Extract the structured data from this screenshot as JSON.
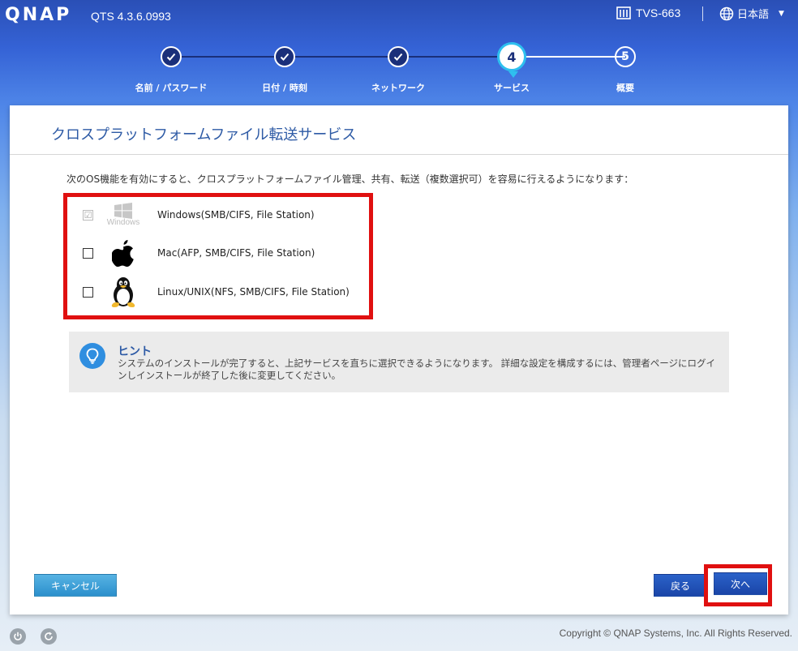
{
  "header": {
    "logo": "QNAP",
    "version": "QTS 4.3.6.0993",
    "device_name": "TVS-663",
    "language": "日本語"
  },
  "steps": [
    {
      "label": "名前 / パスワード",
      "status": "done"
    },
    {
      "label": "日付 / 時刻",
      "status": "done"
    },
    {
      "label": "ネットワーク",
      "status": "done"
    },
    {
      "label": "サービス",
      "status": "current",
      "number": "4"
    },
    {
      "label": "概要",
      "status": "todo",
      "number": "5"
    }
  ],
  "panel": {
    "title": "クロスプラットフォームファイル転送サービス",
    "intro": "次のOS機能を有効にすると、クロスプラットフォームファイル管理、共有、転送（複数選択可）を容易に行えるようになります：",
    "options": [
      {
        "label": "Windows(SMB/CIFS, File Station)",
        "checked": true,
        "disabled": true,
        "icon": "windows-logo-icon",
        "icon_caption": "Windows"
      },
      {
        "label": "Mac(AFP, SMB/CIFS, File Station)",
        "checked": false,
        "disabled": false,
        "icon": "apple-logo-icon"
      },
      {
        "label": "Linux/UNIX(NFS, SMB/CIFS, File Station)",
        "checked": false,
        "disabled": false,
        "icon": "tux-penguin-icon"
      }
    ],
    "hint": {
      "title": "ヒント",
      "text": "システムのインストールが完了すると、上記サービスを直ちに選択できるようになります。 詳細な設定を構成するには、管理者ページにログインしインストールが終了した後に変更してください。"
    }
  },
  "buttons": {
    "cancel": "キャンセル",
    "back": "戻る",
    "next": "次へ"
  },
  "footer": {
    "copyright": "Copyright © QNAP Systems, Inc. All Rights Reserved."
  },
  "colors": {
    "accent": "#2d5aa5",
    "highlight": "#e01010",
    "step_ring": "#2ec0ef"
  }
}
